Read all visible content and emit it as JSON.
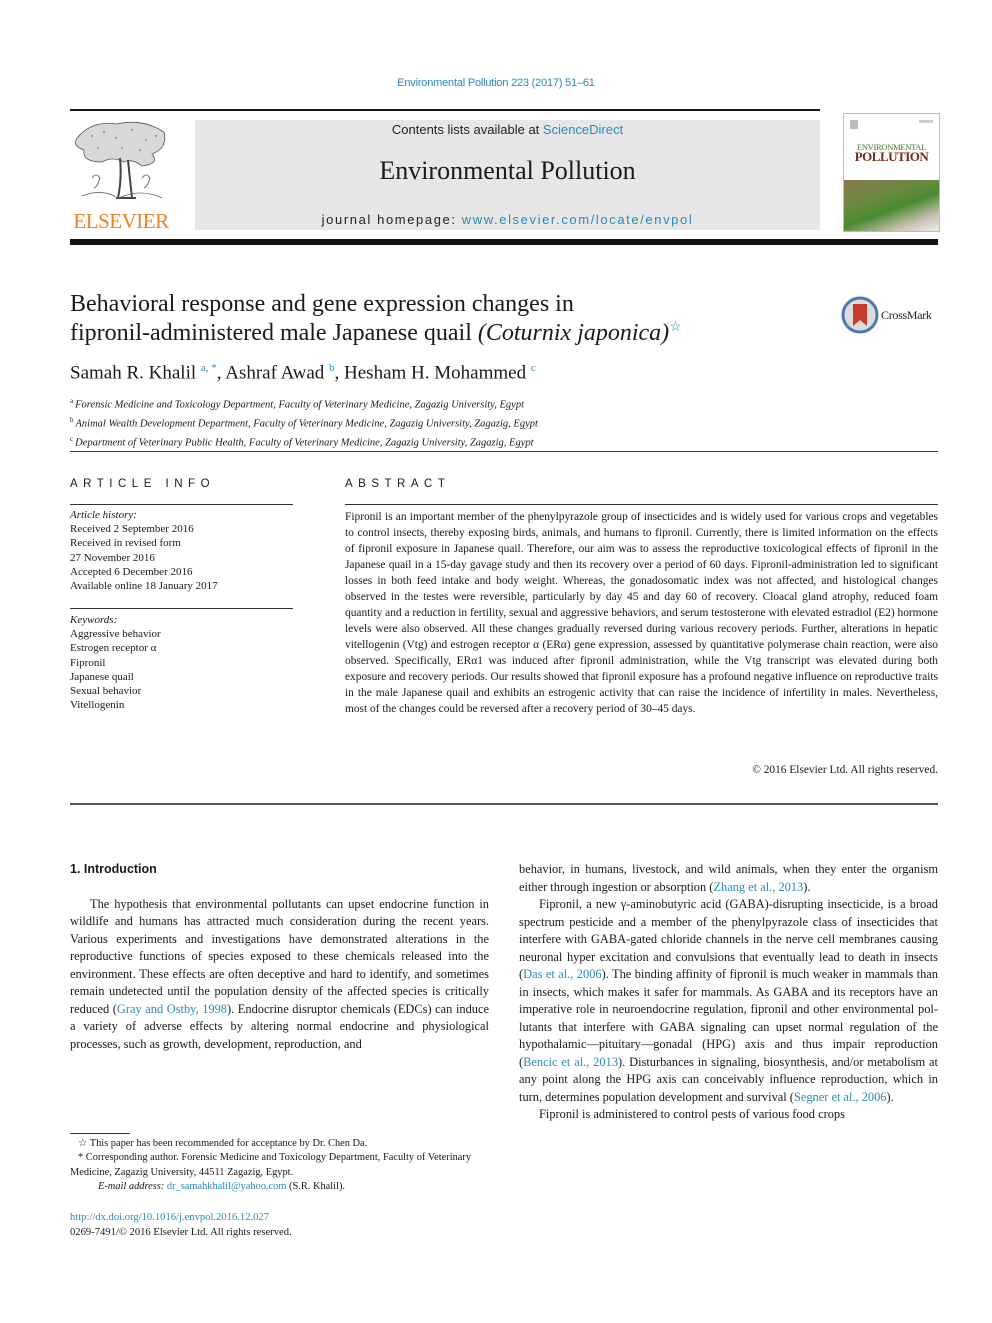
{
  "header": {
    "running_head": "Environmental Pollution 223 (2017) 51–61",
    "contents_prefix": "Contents lists available at ",
    "contents_link": "ScienceDirect",
    "journal_title": "Environmental Pollution",
    "homepage_prefix": "journal homepage: ",
    "homepage_link": "www.elsevier.com/locate/envpol",
    "publisher_logo_text": "ELSEVIER",
    "cover_title_line1": "ENVIRONMENTAL",
    "cover_title_line2": "POLLUTION",
    "crossmark_label": "CrossMark"
  },
  "article": {
    "title_line1": "Behavioral response and gene expression changes in",
    "title_line2_prefix": "fipronil-administered male Japanese quail ",
    "title_species": "(Coturnix japonica)",
    "title_star": "☆",
    "authors": [
      {
        "name": "Samah R. Khalil",
        "sup": "a, *"
      },
      {
        "name": "Ashraf Awad",
        "sup": "b"
      },
      {
        "name": "Hesham H. Mohammed",
        "sup": "c"
      }
    ],
    "affiliations": [
      {
        "key": "a",
        "text": "Forensic Medicine and Toxicology Department, Faculty of Veterinary Medicine, Zagazig University, Egypt"
      },
      {
        "key": "b",
        "text": "Animal Wealth Development Department, Faculty of Veterinary Medicine, Zagazig University, Zagazig, Egypt"
      },
      {
        "key": "c",
        "text": "Department of Veterinary Public Health, Faculty of Veterinary Medicine, Zagazig University, Zagazig, Egypt"
      }
    ]
  },
  "article_info": {
    "heading": "ARTICLE INFO",
    "history_label": "Article history:",
    "history": [
      "Received 2 September 2016",
      "Received in revised form",
      "27 November 2016",
      "Accepted 6 December 2016",
      "Available online 18 January 2017"
    ],
    "keywords_label": "Keywords:",
    "keywords": [
      "Aggressive behavior",
      "Estrogen receptor α",
      "Fipronil",
      "Japanese quail",
      "Sexual behavior",
      "Vitellogenin"
    ]
  },
  "abstract": {
    "heading": "ABSTRACT",
    "text": "Fipronil is an important member of the phenylpyrazole group of insecticides and is widely used for various crops and vegetables to control insects, thereby exposing birds, animals, and humans to fipronil. Currently, there is limited information on the effects of fipronil exposure in Japanese quail. Therefore, our aim was to assess the reproductive toxicological effects of fipronil in the Japanese quail in a 15-day gavage study and then its recovery over a period of 60 days. Fipronil-administration led to significant losses in both feed intake and body weight. Whereas, the gonadosomatic index was not affected, and histological changes observed in the testes were reversible, particularly by day 45 and day 60 of recovery. Cloacal gland atrophy, reduced foam quantity and a reduction in fertility, sexual and aggressive behav­iors, and serum testosterone with elevated estradiol (E2) hormone levels were also observed. All these changes gradually reversed during various recovery periods. Further, alterations in hepatic vitellogenin (Vtg) and estrogen receptor α (ERα) gene expression, assessed by quantitative polymerase chain reaction, were also observed. Specifically, ERα1 was induced after fipronil administration, while the Vtg transcript was elevated during both exposure and recovery periods. Our results showed that fipronil exposure has a profound negative influence on reproductive traits in the male Japanese quail and exhibits an estrogenic activity that can raise the incidence of infertility in males. Nevertheless, most of the changes could be reversed after a recovery period of 30–45 days.",
    "copyright": "© 2016 Elsevier Ltd. All rights reserved."
  },
  "body": {
    "section_title": "1.  Introduction",
    "left_p1_a": "The hypothesis that environmental pollutants can upset endo­crine function in wildlife and humans has attracted much consid­eration during the recent years. Various experiments and investigations have demonstrated alterations in the reproductive functions of species exposed to these chemicals released into the environment. These effects are often deceptive and hard to identify, and sometimes remain undetected until the population density of the affected species is critically reduced (",
    "left_p1_cite": "Gray and Ostby, 1998",
    "left_p1_b": "). Endocrine disruptor chemicals (EDCs) can induce a variety of adverse effects by altering normal endocrine and physiological processes, such as growth, development, reproduction, and",
    "right_p1_a": "behavior, in humans, livestock, and wild animals, when they enter the organism either through ingestion or absorption (",
    "right_p1_cite": "Zhang et al., 2013",
    "right_p1_b": ").",
    "right_p2_a": "Fipronil, a new γ-aminobutyric acid (GABA)-disrupting insecti­cide, is a broad spectrum pesticide and a member of the phenyl­pyrazole class of insecticides that interfere with GABA-gated chloride channels in the nerve cell membranes causing neuronal hyper excitation and convulsions that eventually lead to death in insects (",
    "right_p2_cite1": "Das et al., 2006",
    "right_p2_b": "). The binding affinity of fipronil is much weaker in mammals than in insects, which makes it safer for mammals. As GABA and its receptors have an imperative role in neuroendocrine regulation, fipronil and other environmental pol­lutants that interfere with GABA signaling can upset normal regu­lation of the hypothalamic—pituitary—gonadal (HPG) axis and thus impair reproduction (",
    "right_p2_cite2": "Bencic et al., 2013",
    "right_p2_c": "). Disturbances in signaling, biosynthesis, and/or metabolism at any point along the HPG axis can conceivably influence reproduction, which in turn, determines population development and survival (",
    "right_p2_cite3": "Segner et al., 2006",
    "right_p2_d": ").",
    "right_p3": "Fipronil is administered to control pests of various food crops"
  },
  "footnotes": {
    "fn1": "☆  This paper has been recommended for acceptance by Dr. Chen Da.",
    "fn2": "* Corresponding author. Forensic Medicine and Toxicology Department, Faculty of Veterinary Medicine, Zagazig University, 44511 Zagazig, Egypt.",
    "email_label": "E-mail address: ",
    "email": "dr_samahkhalil@yahoo.com",
    "email_suffix": " (S.R. Khalil).",
    "doi": "http://dx.doi.org/10.1016/j.envpol.2016.12.027",
    "issn_line": "0269-7491/© 2016 Elsevier Ltd. All rights reserved."
  },
  "colors": {
    "link": "#2a8ab8",
    "elsevier_orange": "#f08020",
    "journal_box": "#e6e6e6"
  }
}
